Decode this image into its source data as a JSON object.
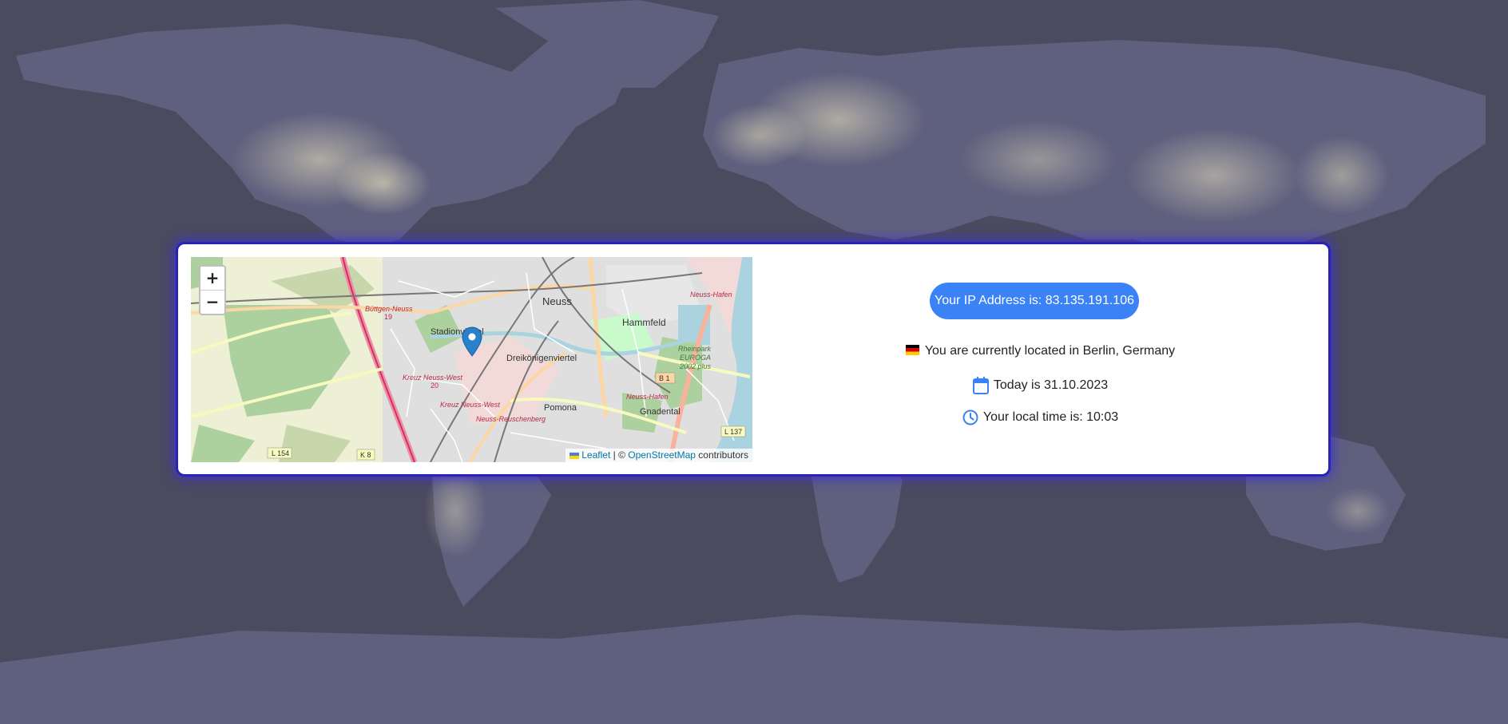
{
  "ip": {
    "label": "Your IP Address is: 83.135.191.106"
  },
  "location": {
    "text": "You are currently located in Berlin, Germany",
    "flag_icon": "germany-flag-icon"
  },
  "date": {
    "text": "Today is 31.10.2023",
    "icon": "calendar-icon"
  },
  "time": {
    "text": "Your local time is: 10:03",
    "icon": "clock-icon"
  },
  "map": {
    "zoom_in": "+",
    "zoom_out": "−",
    "attribution": {
      "leaflet": "Leaflet",
      "separator": " | © ",
      "osm": "OpenStreetMap",
      "suffix": " contributors"
    },
    "labels": {
      "neuss": "Neuss",
      "hammfeld": "Hammfeld",
      "stadionviertel": "Stadionviertel",
      "dreikoenigenviertel": "Dreikönigenviertel",
      "pomona": "Pomona",
      "gnadental": "Gnadental",
      "buttgen": "Büttgen-Neuss",
      "b19": "19",
      "neuss_hafen_top": "Neuss-Hafen",
      "kreuz_west": "Kreuz Neuss-West",
      "kreuz_west_20": "20",
      "kreuz_west2": "Kreuz Neuss-West",
      "neuss_hafen_bottom": "Neuss-Hafen",
      "reuschenberg": "Neuss-Reuschenberg",
      "rheinpark": "Rheinpark",
      "europa": "EUROGA",
      "plus2002": "2002 plus",
      "b1": "B 1",
      "l154": "L 154",
      "k8": "K 8",
      "l137": "L 137"
    }
  },
  "colors": {
    "accent": "#3b82f6",
    "card_glow": "#2a23b8",
    "background": "#4a4a5e"
  }
}
